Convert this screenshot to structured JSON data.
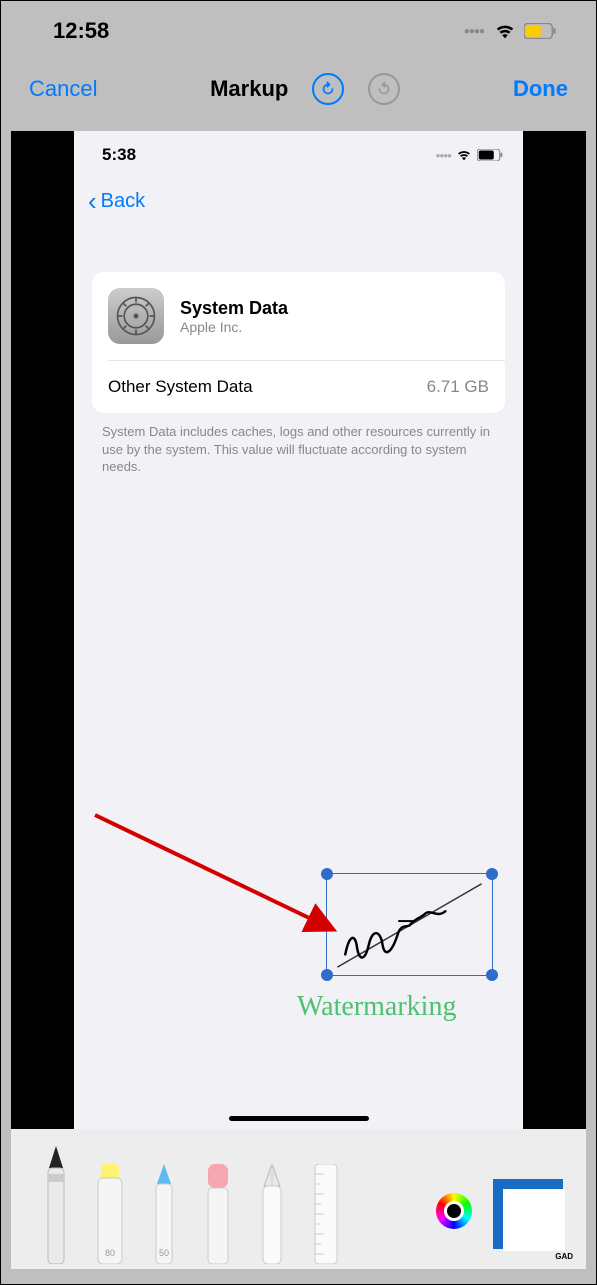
{
  "outer": {
    "time": "12:58"
  },
  "toolbar": {
    "cancel": "Cancel",
    "title": "Markup",
    "done": "Done"
  },
  "inner": {
    "time": "5:38",
    "back": "Back",
    "card_title": "System Data",
    "card_subtitle": "Apple Inc.",
    "other_label": "Other System Data",
    "other_value": "6.71 GB",
    "footer": "System Data includes caches, logs and other resources currently in use by the system. This value will fluctuate according to system needs."
  },
  "watermark_label": "Watermarking",
  "tool_labels": {
    "marker": "80",
    "pen": "50"
  },
  "overlay_text": "GAD"
}
